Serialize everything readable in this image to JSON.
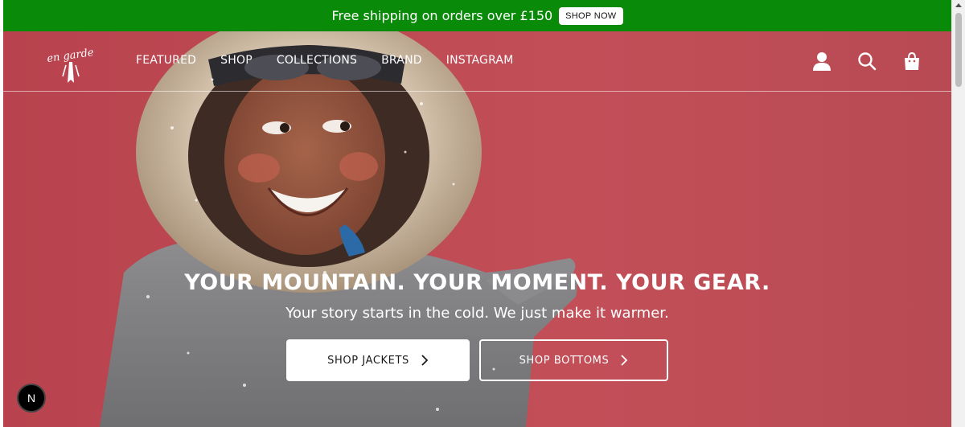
{
  "announcement": {
    "text": "Free shipping on orders over £150",
    "button_label": "SHOP NOW",
    "bg_color": "#0a8a09"
  },
  "brand": {
    "logo_text": "en garde"
  },
  "nav": {
    "items": [
      {
        "label": "FEATURED"
      },
      {
        "label": "SHOP"
      },
      {
        "label": "COLLECTIONS"
      },
      {
        "label": "BRAND"
      },
      {
        "label": "INSTAGRAM"
      }
    ]
  },
  "header_icons": [
    "account-icon",
    "search-icon",
    "cart-bag-icon"
  ],
  "hero": {
    "headline": "YOUR MOUNTAIN. YOUR MOMENT. YOUR GEAR.",
    "subline": "Your story starts in the cold. We just make it warmer.",
    "primary_cta": "SHOP JACKETS",
    "secondary_cta": "SHOP BOTTOMS",
    "bg_color": "#c24f58"
  },
  "dev_badge": {
    "label": "N"
  }
}
